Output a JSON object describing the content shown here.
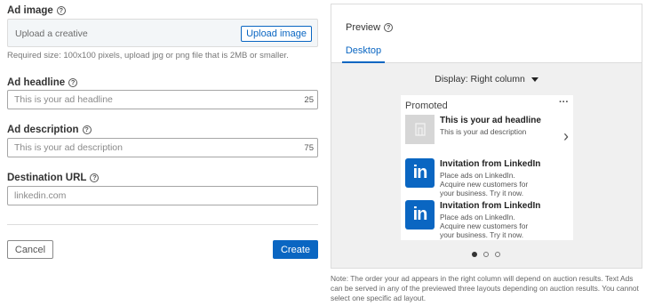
{
  "form": {
    "ad_image_label": "Ad image",
    "upload_placeholder": "Upload a creative",
    "upload_button": "Upload image",
    "upload_hint": "Required size: 100x100 pixels, upload jpg or png file that is 2MB or smaller.",
    "headline_label": "Ad headline",
    "headline_placeholder": "This is your ad headline",
    "headline_counter": "25",
    "description_label": "Ad description",
    "description_placeholder": "This is your ad description",
    "description_counter": "75",
    "url_label": "Destination URL",
    "url_placeholder": "linkedin.com",
    "cancel_button": "Cancel",
    "create_button": "Create"
  },
  "preview": {
    "title": "Preview",
    "tab_desktop": "Desktop",
    "display_label": "Display: Right column",
    "promoted": "Promoted",
    "more": "···",
    "ad1": {
      "title": "This is your ad headline",
      "desc": "This is your ad description"
    },
    "ad2": {
      "title": "Invitation from LinkedIn",
      "desc": "Place ads on LinkedIn. Acquire new customers for your business. Try it now."
    },
    "ad3": {
      "title": "Invitation from LinkedIn",
      "desc": "Place ads on LinkedIn. Acquire new customers for your business. Try it now."
    },
    "logo_text": "in",
    "next": "›",
    "pagination": {
      "current": 1,
      "total": 3
    },
    "note": "Note: The order your ad appears in the right column will depend on auction results. Text Ads can be served in any of the previewed three layouts depending on auction results. You cannot select one specific ad layout."
  },
  "colors": {
    "accent": "#0a66c2",
    "panel_bg": "#f0f0f0"
  }
}
